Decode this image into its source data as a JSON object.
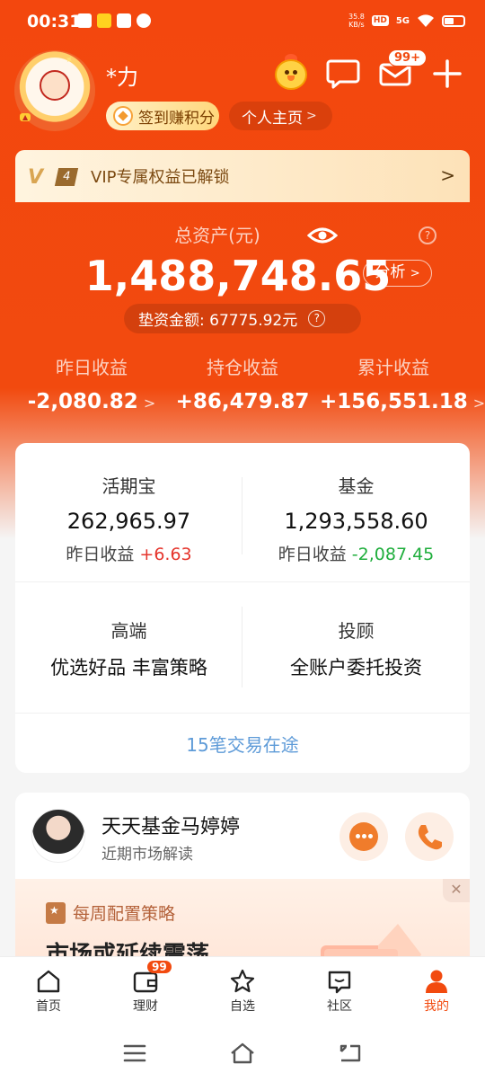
{
  "status_bar": {
    "time": "00:31",
    "speed": "35.8\nKB/s",
    "net_badge": "HD",
    "network": "5G"
  },
  "header": {
    "username": "*力",
    "points_label": "签到赚积分",
    "home_label": "个人主页",
    "mail_badge": "99+"
  },
  "vip": {
    "level": "4",
    "text": "VIP专属权益已解锁"
  },
  "assets": {
    "label": "总资产(元)",
    "total": "1,488,748.65",
    "analyze_label": "分析",
    "margin_text": "垫资金额: 67775.92元"
  },
  "earnings": [
    {
      "label": "昨日收益",
      "value": "-2,080.82"
    },
    {
      "label": "持仓收益",
      "value": "+86,479.87"
    },
    {
      "label": "累计收益",
      "value": "+156,551.18"
    }
  ],
  "products": {
    "huoqibao": {
      "title": "活期宝",
      "value": "262,965.97",
      "sub_label": "昨日收益",
      "sub_value": "+6.63"
    },
    "fund": {
      "title": "基金",
      "value": "1,293,558.60",
      "sub_label": "昨日收益",
      "sub_value": "-2,087.45"
    },
    "premium": {
      "title": "高端",
      "desc": "优选好品 丰富策略"
    },
    "advisory": {
      "title": "投顾",
      "desc": "全账户委托投资"
    },
    "transit": "15笔交易在途"
  },
  "advisor": {
    "name": "天天基金马婷婷",
    "desc": "近期市场解读",
    "strategy_tag": "每周配置策略",
    "strategy_title": "市场或延续震荡"
  },
  "tabs": [
    {
      "label": "首页",
      "icon": "home-icon"
    },
    {
      "label": "理财",
      "icon": "wallet-icon",
      "badge": "99"
    },
    {
      "label": "自选",
      "icon": "star-icon"
    },
    {
      "label": "社区",
      "icon": "community-icon"
    },
    {
      "label": "我的",
      "icon": "person-icon"
    }
  ],
  "colors": {
    "brand": "#f24a0f",
    "up": "#e5342c",
    "down": "#1fae3c",
    "link": "#5e9bd8"
  }
}
